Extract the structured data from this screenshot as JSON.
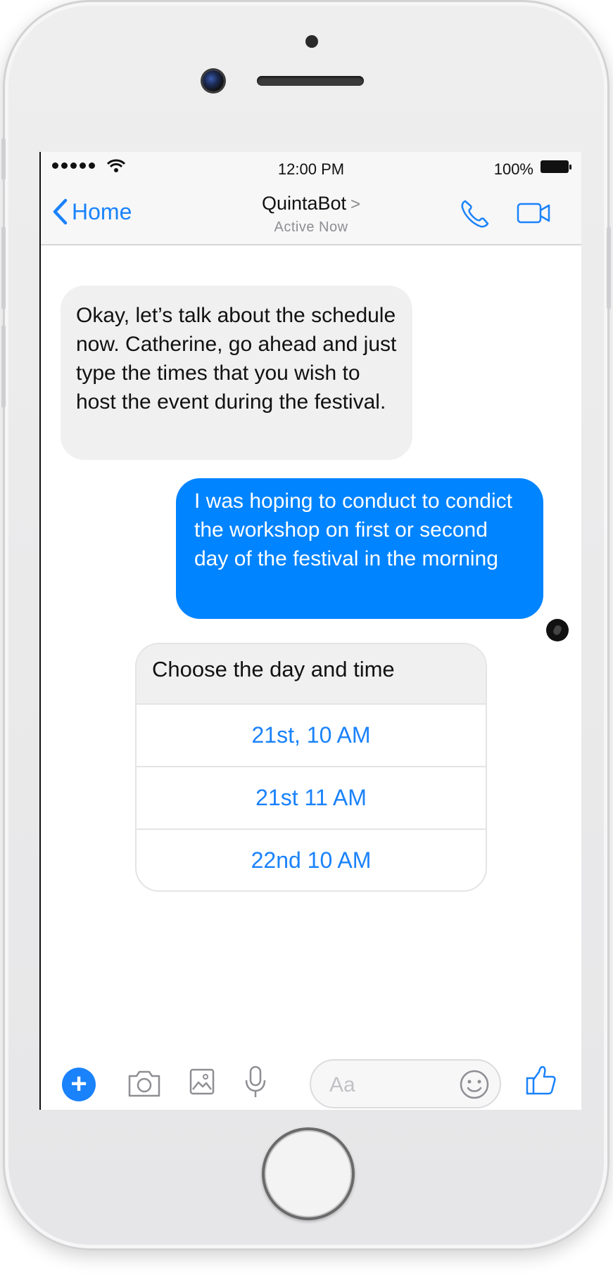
{
  "status_bar": {
    "time": "12:00 PM",
    "battery": "100%"
  },
  "header": {
    "back_label": "Home",
    "contact_name": "QuintaBot",
    "chevron": ">",
    "status": "Active Now"
  },
  "messages": [
    {
      "from": "bot",
      "text": "Okay, let’s talk about the schedule now. Catherine, go ahead and just type the times that you wish to host the event during the festival."
    },
    {
      "from": "user",
      "text": "I was hoping to conduct to condict the workshop on first or second day of the festival in the morning"
    }
  ],
  "quick_reply": {
    "prompt": "Choose the day and time",
    "options": [
      "21st, 10 AM",
      "21st 11 AM",
      "22nd 10 AM"
    ]
  },
  "composer": {
    "plus": "+",
    "placeholder": "Aa"
  },
  "colors": {
    "accent": "#1a82fb",
    "outgoing_bubble": "#0084ff",
    "incoming_bubble": "#f1f0f0"
  },
  "icons": [
    "back-chevron-icon",
    "phone-icon",
    "video-camera-icon",
    "plus-icon",
    "camera-icon",
    "image-icon",
    "microphone-icon",
    "emoji-icon",
    "thumbs-up-icon",
    "wifi-icon",
    "battery-icon"
  ]
}
